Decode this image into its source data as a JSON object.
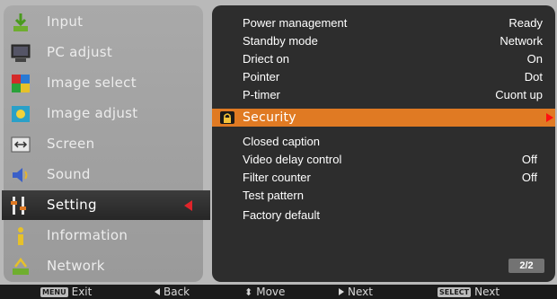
{
  "left_menu": {
    "items": [
      {
        "label": "Input",
        "icon": "input-icon"
      },
      {
        "label": "PC adjust",
        "icon": "pc-adjust-icon"
      },
      {
        "label": "Image select",
        "icon": "image-select-icon"
      },
      {
        "label": "Image adjust",
        "icon": "image-adjust-icon"
      },
      {
        "label": "Screen",
        "icon": "screen-icon"
      },
      {
        "label": "Sound",
        "icon": "sound-icon"
      },
      {
        "label": "Setting",
        "icon": "setting-icon",
        "active": true
      },
      {
        "label": "Information",
        "icon": "information-icon"
      },
      {
        "label": "Network",
        "icon": "network-icon"
      }
    ]
  },
  "settings_panel": {
    "rows": [
      {
        "label": "Power management",
        "value": "Ready"
      },
      {
        "label": "Standby mode",
        "value": "Network"
      },
      {
        "label": "Driect on",
        "value": "On"
      },
      {
        "label": "Pointer",
        "value": "Dot"
      },
      {
        "label": "P-timer",
        "value": "Cuont up"
      },
      {
        "label": "Security",
        "value": "",
        "highlighted": true
      },
      {
        "label": "Closed caption",
        "value": ""
      },
      {
        "label": "Video delay control",
        "value": "Off"
      },
      {
        "label": "Filter counter",
        "value": "Off"
      },
      {
        "label": "Test pattern",
        "value": ""
      },
      {
        "label": "Factory default",
        "value": ""
      }
    ],
    "page_indicator": "2/2"
  },
  "bottom_bar": {
    "menu_key": "MENU",
    "exit_label": "Exit",
    "back_label": "Back",
    "move_label": "Move",
    "next_label": "Next",
    "select_key": "SELECT",
    "select_next_label": "Next"
  },
  "colors": {
    "highlight": "#e07a23",
    "arrow_red": "#e0242a",
    "panel_dark": "#2d2d2d",
    "menu_grey": "#a0a0a0"
  }
}
